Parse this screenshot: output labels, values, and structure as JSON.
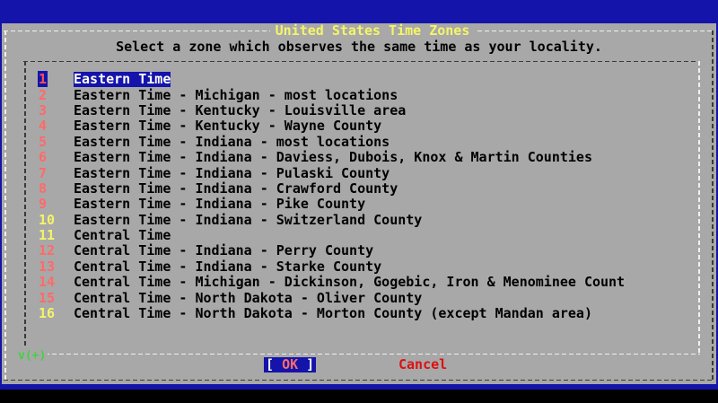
{
  "dialog": {
    "title": "United States Time Zones",
    "prompt": "Select a zone which observes the same time as your locality."
  },
  "menu": {
    "items": [
      {
        "tag": "1",
        "label": "Eastern Time",
        "selected": true
      },
      {
        "tag": "2",
        "label": "Eastern Time - Michigan - most locations"
      },
      {
        "tag": "3",
        "label": "Eastern Time - Kentucky - Louisville area"
      },
      {
        "tag": "4",
        "label": "Eastern Time - Kentucky - Wayne County"
      },
      {
        "tag": "5",
        "label": "Eastern Time - Indiana - most locations"
      },
      {
        "tag": "6",
        "label": "Eastern Time - Indiana - Daviess, Dubois, Knox & Martin Counties"
      },
      {
        "tag": "7",
        "label": "Eastern Time - Indiana - Pulaski County"
      },
      {
        "tag": "8",
        "label": "Eastern Time - Indiana - Crawford County"
      },
      {
        "tag": "9",
        "label": "Eastern Time - Indiana - Pike County"
      },
      {
        "tag": "10",
        "label": "Eastern Time - Indiana - Switzerland County"
      },
      {
        "tag": "11",
        "label": "Central Time"
      },
      {
        "tag": "12",
        "label": "Central Time - Indiana - Perry County"
      },
      {
        "tag": "13",
        "label": "Central Time - Indiana - Starke County"
      },
      {
        "tag": "14",
        "label": "Central Time - Michigan - Dickinson, Gogebic, Iron & Menominee Count"
      },
      {
        "tag": "15",
        "label": "Central Time - North Dakota - Oliver County"
      },
      {
        "tag": "16",
        "label": "Central Time - North Dakota - Morton County (except Mandan area)"
      }
    ],
    "scroll_indicator": "v(+)"
  },
  "buttons": {
    "ok_label": "OK",
    "cancel_label": "Cancel"
  },
  "colors": {
    "screen_background": "#1414aa",
    "dialog_background": "#a8a8a8",
    "title_color": "#f4f46a",
    "selection_background": "#1414aa",
    "tag_red": "#ff6a6a",
    "tag_yellow": "#f4f46a",
    "scroll_indicator": "#3fd43f"
  }
}
